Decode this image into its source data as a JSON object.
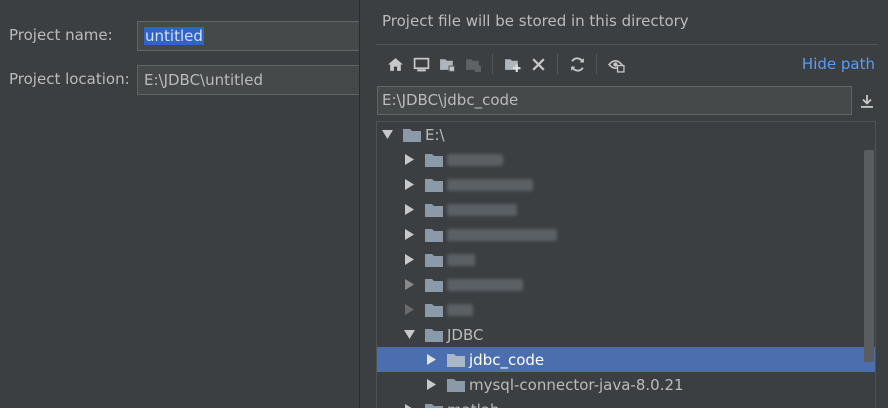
{
  "form": {
    "project_name_label": "Project name:",
    "project_name_value": "untitled",
    "project_location_label": "Project location:",
    "project_location_value": "E:\\JDBC\\untitled"
  },
  "popup": {
    "title": "Project file will be stored in this directory",
    "hide_path_label": "Hide path",
    "path_value": "E:\\JDBC\\jdbc_code",
    "toolbar": [
      "home-icon",
      "desktop-icon",
      "project-folder-icon",
      "module-folder-icon",
      "new-folder-icon",
      "delete-icon",
      "refresh-icon",
      "show-hidden-icon"
    ]
  },
  "tree": {
    "root_label": "E:\\",
    "jdbc_label": "JDBC",
    "jdbc_code_label": "jdbc_code",
    "mysql_label": "mysql-connector-java-8.0.21",
    "matlab_label": "matlab"
  },
  "colors": {
    "background": "#3c3f41",
    "selection": "#4b6eaf",
    "link": "#589df6",
    "folder": "#8a9aa9"
  }
}
